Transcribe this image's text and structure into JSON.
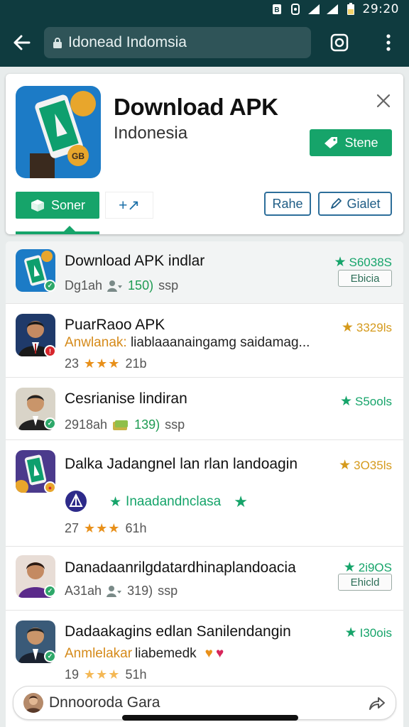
{
  "status_bar": {
    "time": "29:20",
    "icons": [
      "bluetooth-icon",
      "vibrate-icon",
      "signal-icon",
      "signal-icon",
      "battery-icon"
    ]
  },
  "browser": {
    "url": "Idonead Indomsia",
    "icons": [
      "back-arrow-icon",
      "lock-icon",
      "tabs-icon",
      "more-vert-icon"
    ]
  },
  "app_card": {
    "title": "Download APK",
    "subtitle": "Indonesia",
    "primary_button": "Stene",
    "tab_active": "Soner",
    "tab_alt": "+↗",
    "button_rate": "Rahe",
    "button_global": "Gialet",
    "colors": {
      "accent": "#16a46a",
      "outline": "#2d6e9a",
      "header": "#0f3b3f"
    }
  },
  "list": {
    "items": [
      {
        "title": "Download APK indlar",
        "meta_left": "Dg1ah",
        "meta_num": "150)",
        "meta_right": "ssp",
        "rank": "S6038S",
        "rank_label": "Ebicia",
        "badge": "check"
      },
      {
        "title": "PuarRaoo APK",
        "subtitle_highlight": "Anwlanak:",
        "subtitle_rest": " liablaaanaingamg saidamag...",
        "meta_left": "23",
        "meta_stars": "★★★",
        "meta_right": "21b",
        "rank": "3329ls",
        "badge": "alert"
      },
      {
        "title": "Cesrianise lindiran",
        "meta_left": "2918ah",
        "meta_num": "139)",
        "meta_right": "ssp",
        "rank": "S5ools",
        "badge": "check"
      },
      {
        "title": "Dalka Jadangnel lan rlan landoagin",
        "promo_text": "Inaadandnclasa",
        "meta_left": "27",
        "meta_stars": "★★★",
        "meta_right": "61h",
        "rank": "3O35ls",
        "badge": "game"
      },
      {
        "title": "Danadaanrilgdatardhinaplandoacia",
        "meta_left": "A31ah",
        "meta_num": "319)",
        "meta_right": "ssp",
        "rank": "2i9OS",
        "rank_label": "Ehicld",
        "badge": "check"
      },
      {
        "title": "Dadaakagins edlan Sanilendangin",
        "subtitle_highlight": "Anmlelakar",
        "subtitle_rest": " liabemedk",
        "meta_left": "19",
        "meta_stars": "★★★",
        "meta_right": "51h",
        "rank": "I30ois",
        "badge": "check"
      }
    ]
  },
  "bottom_bar": {
    "text": "Dnnooroda Gara"
  }
}
